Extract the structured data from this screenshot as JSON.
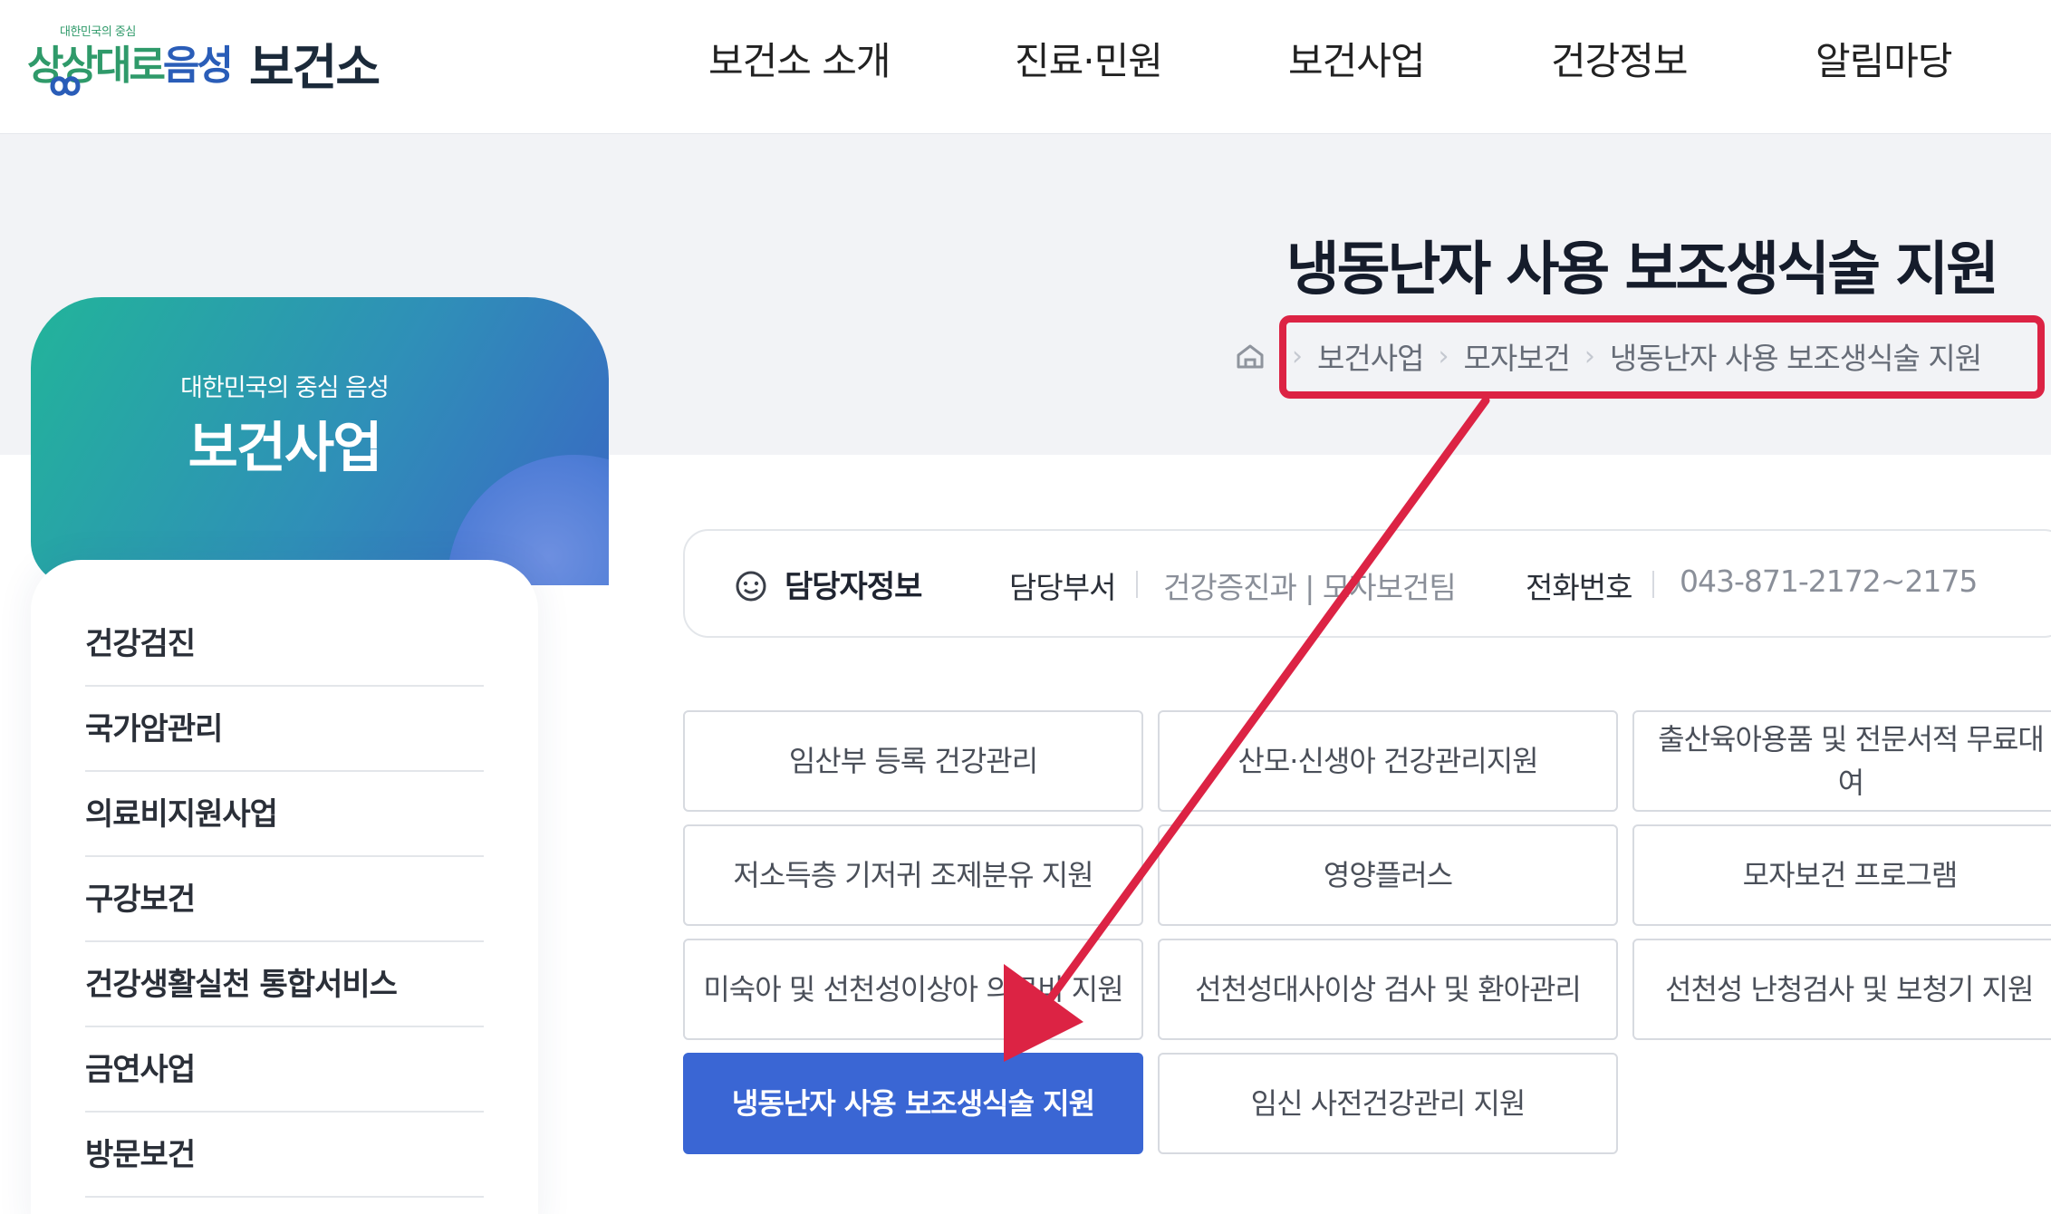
{
  "header": {
    "logo_tagline": "대한민국의 중심",
    "logo_slogan_green": "상상대로",
    "logo_slogan_blue": "음성",
    "logo_name": "보건소",
    "nav": [
      "보건소 소개",
      "진료·민원",
      "보건사업",
      "건강정보",
      "알림마당"
    ]
  },
  "page": {
    "title": "냉동난자 사용 보조생식술 지원",
    "breadcrumb": [
      "보건사업",
      "모자보건",
      "냉동난자 사용 보조생식술 지원"
    ]
  },
  "sidebar": {
    "subtitle": "대한민국의 중심 음성",
    "title": "보건사업",
    "items": [
      "건강검진",
      "국가암관리",
      "의료비지원사업",
      "구강보건",
      "건강생활실천 통합서비스",
      "금연사업",
      "방문보건"
    ]
  },
  "contact": {
    "label": "담당자정보",
    "dept_key": "담당부서",
    "dept_val": "건강증진과 | 모자보건팀",
    "phone_key": "전화번호",
    "phone_val": "043-871-2172~2175"
  },
  "submenu": {
    "items": [
      "임산부 등록 건강관리",
      "산모·신생아 건강관리지원",
      "출산육아용품 및 전문서적 무료대여",
      "저소득층 기저귀 조제분유 지원",
      "영양플러스",
      "모자보건 프로그램",
      "미숙아 및 선천성이상아 의료비 지원",
      "선천성대사이상 검사 및 환아관리",
      "선천성 난청검사 및 보청기 지원",
      "냉동난자 사용 보조생식술 지원",
      "임신 사전건강관리 지원"
    ],
    "active_index": 9
  },
  "colors": {
    "accent_blue": "#3a66d4",
    "annotation_red": "#dc2344",
    "gradient_start": "#22b49a",
    "gradient_end": "#3a66c4"
  }
}
